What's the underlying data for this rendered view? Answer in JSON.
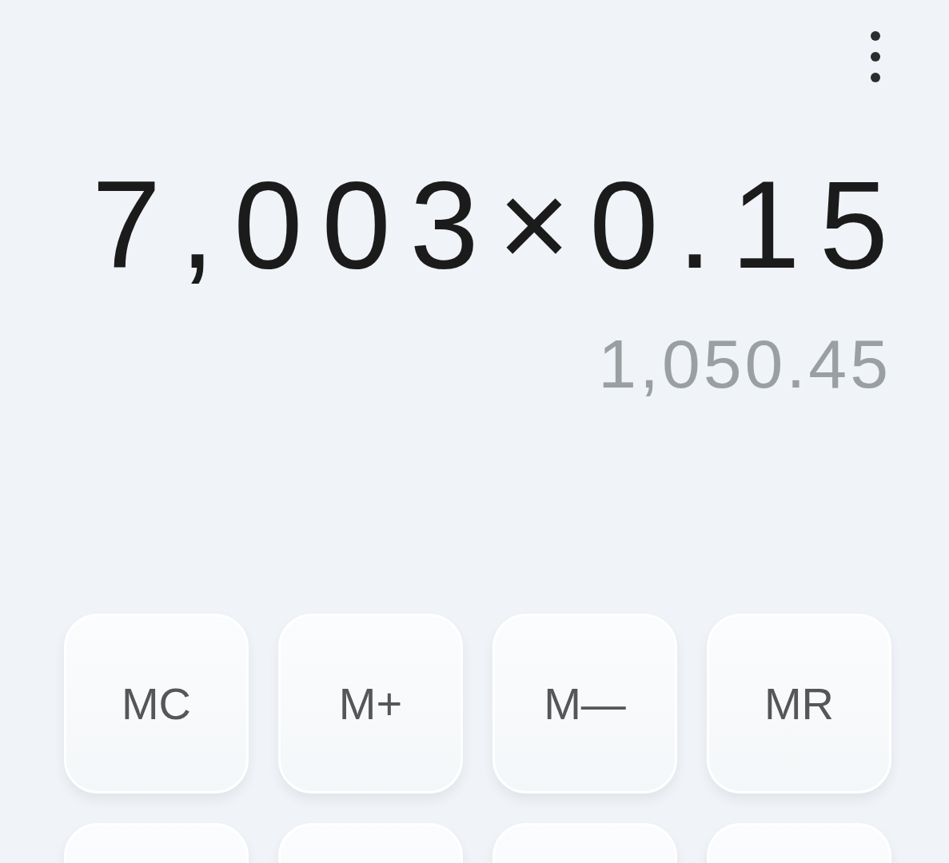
{
  "display": {
    "expression": "7,003×0.15",
    "result": "1,050.45"
  },
  "keypad": {
    "rows": [
      [
        {
          "kind": "label",
          "label": "MC"
        },
        {
          "kind": "label",
          "label": "M+"
        },
        {
          "kind": "label",
          "label": "M—"
        },
        {
          "kind": "label",
          "label": "MR"
        }
      ],
      [
        {
          "kind": "blank"
        },
        {
          "kind": "blank"
        },
        {
          "kind": "blank"
        },
        {
          "kind": "blank"
        }
      ]
    ]
  }
}
